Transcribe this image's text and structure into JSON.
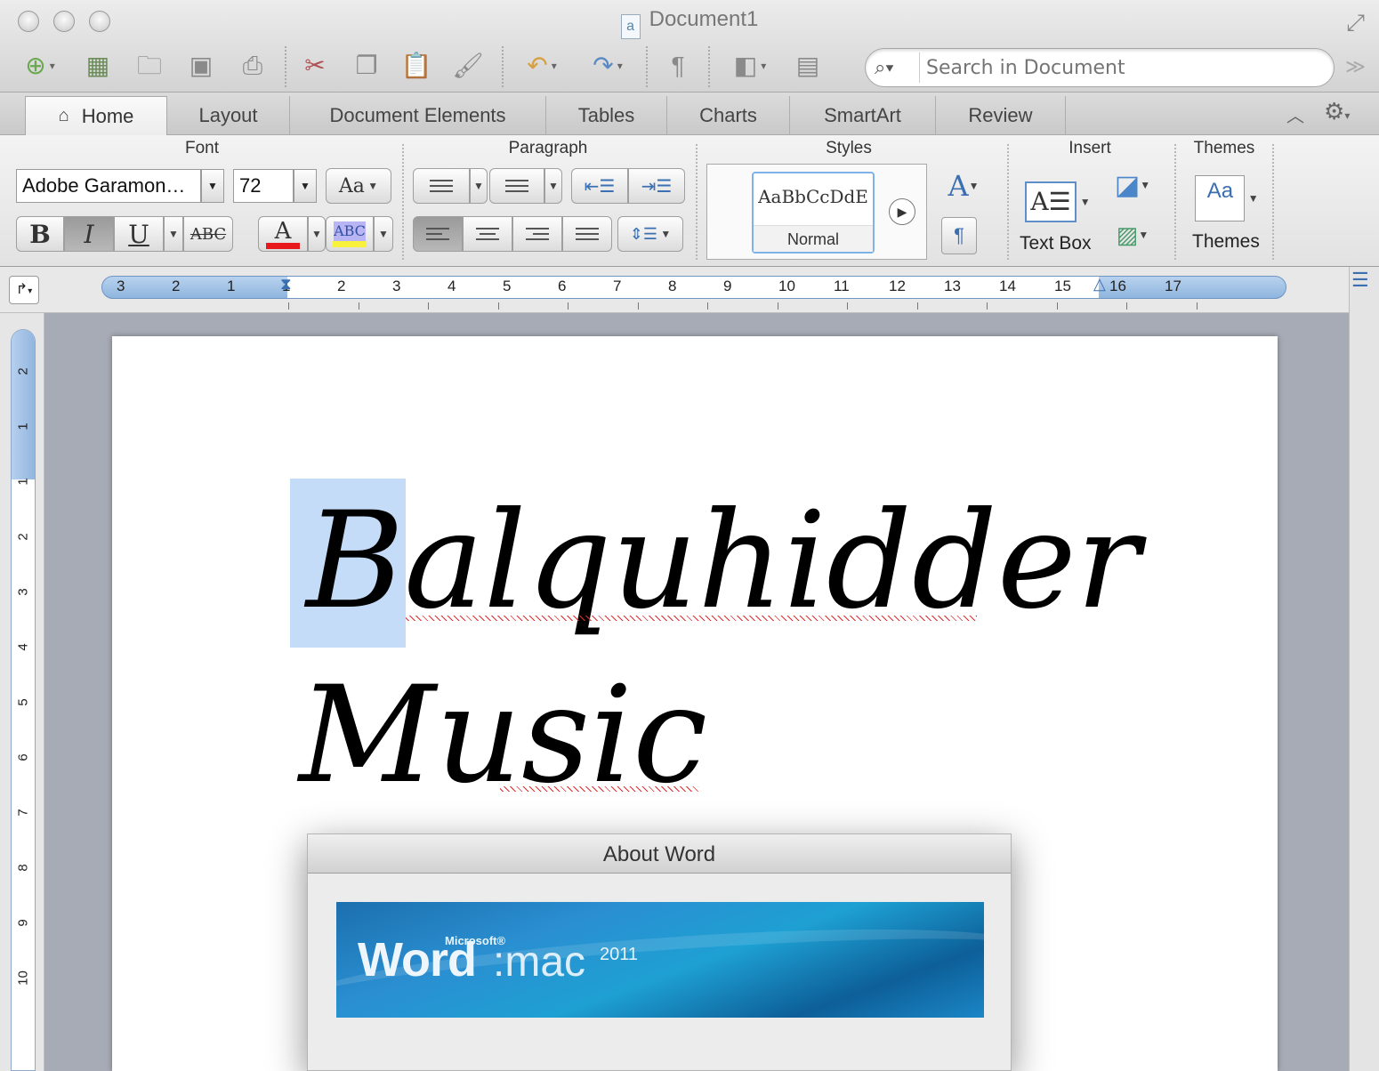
{
  "window": {
    "title": "Document1",
    "close_label": "",
    "minimize_label": "",
    "zoom_label": ""
  },
  "search": {
    "placeholder": "Search in Document",
    "value": ""
  },
  "ribbon_tabs": [
    {
      "label": "Home",
      "active": true
    },
    {
      "label": "Layout"
    },
    {
      "label": "Document Elements"
    },
    {
      "label": "Tables"
    },
    {
      "label": "Charts"
    },
    {
      "label": "SmartArt"
    },
    {
      "label": "Review"
    }
  ],
  "ribbon": {
    "font": {
      "title": "Font",
      "font_name": "Adobe Garamon…",
      "font_size": "72",
      "bold": "B",
      "italic": "I",
      "underline": "U",
      "strike": "ABC",
      "font_color_glyph": "A",
      "highlight_glyph": "ABC",
      "change_case_glyph": "Aa",
      "font_color": "#e8191c",
      "highlight_color": "#f8f23c"
    },
    "paragraph": {
      "title": "Paragraph"
    },
    "styles": {
      "title": "Styles",
      "sample": "AaBbCcDdE",
      "current": "Normal"
    },
    "insert": {
      "title": "Insert",
      "text_box_label": "Text Box"
    },
    "themes": {
      "title": "Themes",
      "label": "Themes",
      "icon_glyph": "Aa"
    }
  },
  "ruler": {
    "h_numbers": [
      "3",
      "2",
      "1",
      "1",
      "2",
      "3",
      "4",
      "5",
      "6",
      "7",
      "8",
      "9",
      "10",
      "11",
      "12",
      "13",
      "14",
      "15",
      "16",
      "17"
    ],
    "v_numbers": [
      "2",
      "1",
      "1",
      "2",
      "3",
      "4",
      "5",
      "6",
      "7",
      "8",
      "9",
      "10"
    ]
  },
  "document": {
    "line1": "Balquhidder",
    "line2": "Music",
    "selected_text": "B"
  },
  "about_dialog": {
    "title": "About Word",
    "banner_microsoft": "Microsoft®",
    "banner_word": "Word",
    "banner_mac": ":mac",
    "banner_year": "2011"
  },
  "colors": {
    "selection": "#c4dcf8",
    "ruler_accent": "#8fb5de",
    "banner_blue": "#1c6fae"
  }
}
